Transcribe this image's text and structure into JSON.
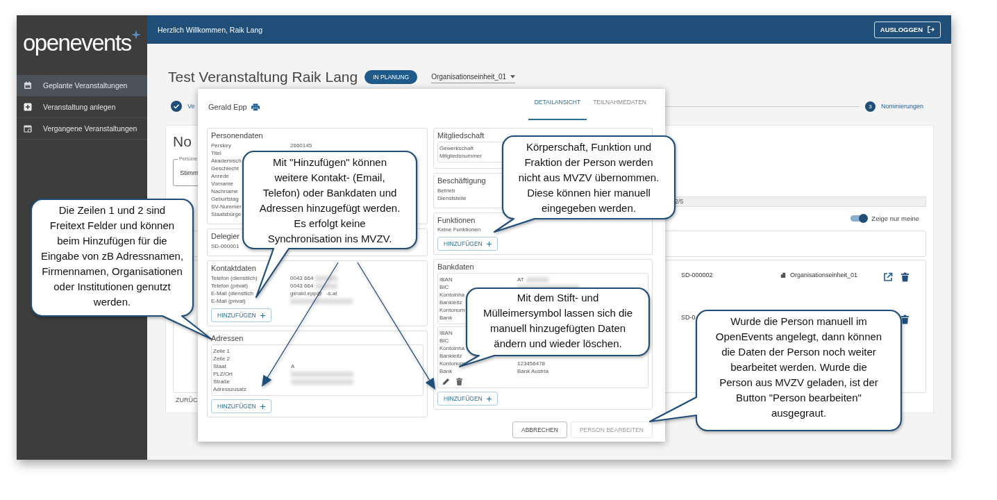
{
  "sidebar": {
    "logo": "openevents",
    "items": [
      {
        "label": "Geplante Veranstaltungen",
        "selected": true
      },
      {
        "label": "Veranstaltung anlegen",
        "selected": false
      },
      {
        "label": "Vergangene Veranstaltungen",
        "selected": false
      }
    ]
  },
  "header": {
    "greeting": "Herzlich Willkommen, Raik Lang",
    "logout_button": "AUSLOGGEN"
  },
  "event": {
    "title": "Test Veranstaltung Raik Lang",
    "status": "IN PLANUNG",
    "org_unit": "Organisationseinheit_01"
  },
  "stepper": [
    {
      "label": "Ve",
      "done": true
    },
    {
      "number": "3",
      "label": "Nominierungen",
      "done": false
    }
  ],
  "card": {
    "title": "No",
    "field": {
      "label": "Persone",
      "value": "Stimm"
    },
    "progress": {
      "reading": "2/5"
    },
    "toggle": {
      "label": "Zeige nur meine",
      "on": true
    },
    "rows": [
      {
        "id": "SD-000002",
        "org": "Organisationseinheit_01",
        "open": true,
        "delete": true
      },
      {
        "id": "SD-0",
        "open": false,
        "delete": true
      }
    ],
    "back_button": "ZURÜC"
  },
  "dialog": {
    "name": "Gerald Epp",
    "tabs": [
      {
        "label": "DETAILANSICHT",
        "selected": true
      },
      {
        "label": "TEILNAHMEDATEN",
        "selected": false
      }
    ],
    "left": [
      {
        "title": "Personendaten",
        "groups": [
          {
            "boxed": false,
            "rows": [
              {
                "label": "Perskey",
                "value": "2660145"
              },
              {
                "label": "Titel"
              },
              {
                "label": "Akademisch"
              },
              {
                "label": "Geschlecht"
              },
              {
                "label": "Anrede"
              },
              {
                "label": "Vorname"
              },
              {
                "label": "Nachname"
              },
              {
                "label": "Geburtstag"
              },
              {
                "label": "SV-Nummer"
              },
              {
                "label": "Staatsbürge"
              }
            ]
          }
        ]
      },
      {
        "title": "Delegier",
        "groups": [
          {
            "boxed": false,
            "rows": [
              {
                "label": "SD-000001"
              }
            ]
          }
        ]
      },
      {
        "title": "Kontaktdaten",
        "groups": [
          {
            "boxed": false,
            "rows": [
              {
                "label": "Telefon (dienstlich)",
                "value": "0043 664",
                "redacted": true
              },
              {
                "label": "Telefon (privat)",
                "value": "0043 664",
                "redacted": true
              },
              {
                "label": "E-Mail (dienstlich",
                "value": "gerald.epp@",
                "value_end": "-s.at"
              },
              {
                "label": "E-Mail (privat)",
                "redacted": true
              }
            ]
          }
        ],
        "add_button": "HINZUFÜGEN"
      },
      {
        "title": "Adressen",
        "groups": [
          {
            "boxed": true,
            "rows": [
              {
                "label": "Zeile 1"
              },
              {
                "label": "Zeile 2"
              },
              {
                "label": "Staat",
                "value": "A"
              },
              {
                "label": "PLZ/Ort",
                "redacted": true
              },
              {
                "label": "Straße",
                "redacted": true
              },
              {
                "label": "Adresszusatz"
              }
            ]
          }
        ],
        "add_button": "HINZUFÜGEN"
      }
    ],
    "right": [
      {
        "title": "Mitgliedschaft",
        "groups": [
          {
            "boxed": true,
            "rows": [
              {
                "label": "Gewerkschaft"
              },
              {
                "label": "Mitgliedsnummer"
              }
            ]
          }
        ]
      },
      {
        "title": "Beschäftigung",
        "groups": [
          {
            "boxed": false,
            "rows": [
              {
                "label": "Betrieb"
              },
              {
                "label": "Dienststelle"
              }
            ]
          }
        ]
      },
      {
        "title": "Funktionen",
        "empty_text": "Keine Funktionen",
        "add_button": "HINZUFÜGEN"
      },
      {
        "title": "Bankdaten",
        "groups": [
          {
            "boxed": true,
            "rows": [
              {
                "label": "IBAN",
                "value": "AT",
                "redacted": true
              },
              {
                "label": "BIC",
                "redacted": true
              },
              {
                "label": "Kontoinha"
              },
              {
                "label": "Bankleitz"
              },
              {
                "label": "Kontonum"
              },
              {
                "label": "Bank"
              }
            ]
          },
          {
            "boxed": true,
            "editable": true,
            "rows": [
              {
                "label": "IBAN"
              },
              {
                "label": "BIC"
              },
              {
                "label": "Kontoinha"
              },
              {
                "label": "Bankleitz"
              },
              {
                "label": "Kontonum",
                "value": "123456478"
              },
              {
                "label": "Bank",
                "value": "Bank Austria"
              }
            ]
          }
        ],
        "add_button": "HINZUFÜGEN"
      }
    ],
    "buttons": [
      {
        "label": "ABBRECHEN",
        "disabled": false
      },
      {
        "label": "PERSON BEARBEITEN",
        "disabled": true
      }
    ]
  },
  "annotations": [
    {
      "text": "Die Zeilen 1 und 2 sind\nFreitext Felder und können\nbeim Hinzufügen für die\nEingabe von zB Adressnamen,\nFirmennamen, Organisationen\noder Institutionen genutzt\nwerden."
    },
    {
      "text": "Mit \"Hinzufügen\" können\nweitere Kontakt- (Email,\nTelefon) oder Bankdaten und\nAdressen hinzugefügt werden.\nEs erfolgt keine\nSynchronisation ins MVZV."
    },
    {
      "text": "Körperschaft, Funktion und\nFraktion der Person werden\nnicht aus MVZV übernommen.\nDiese können hier manuell\neingegeben werden."
    },
    {
      "text": "Mit dem Stift- und\nMülleimersymbol lassen sich die\nmanuell hinzugefügten Daten\nändern und wieder löschen."
    },
    {
      "text": "Wurde die Person manuell im\nOpenEvents angelegt, dann können\ndie Daten der Person noch weiter\nbearbeitet werden. Wurde die\nPerson aus MVZV geladen, ist der\nButton \"Person bearbeiten\"\nausgegraut."
    }
  ]
}
